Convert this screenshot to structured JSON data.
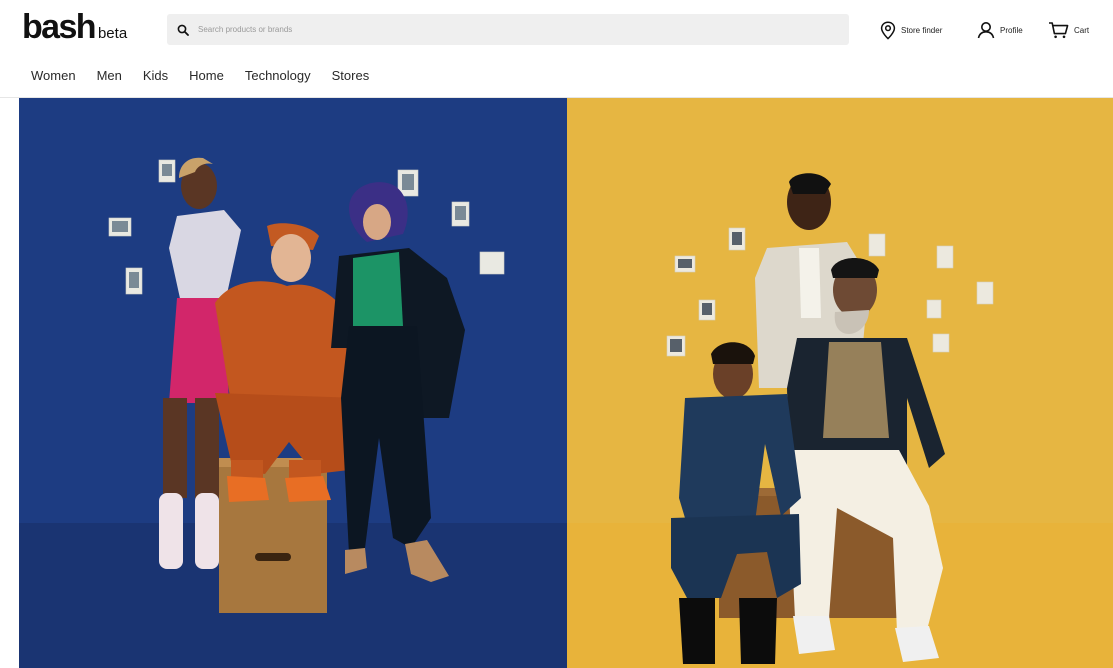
{
  "brand": {
    "name": "bash",
    "tag": "beta"
  },
  "search": {
    "placeholder": "Search products or brands"
  },
  "utility": {
    "store_finder": {
      "label": "Store finder",
      "icon": "location-pin-icon"
    },
    "profile": {
      "label": "Profile",
      "icon": "user-icon"
    },
    "cart": {
      "label": "Cart",
      "icon": "cart-icon"
    }
  },
  "nav": {
    "items": [
      {
        "label": "Women"
      },
      {
        "label": "Men"
      },
      {
        "label": "Kids"
      },
      {
        "label": "Home"
      },
      {
        "label": "Technology"
      },
      {
        "label": "Stores"
      }
    ]
  },
  "hero": {
    "left": {
      "background": "#1c3a7e",
      "floor": "#1a3370"
    },
    "right": {
      "background": "#e6b63f",
      "floor": "#e8b23a"
    }
  }
}
